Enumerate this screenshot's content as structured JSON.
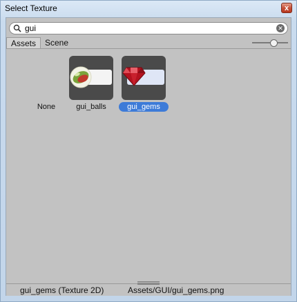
{
  "window": {
    "title": "Select Texture",
    "close_glyph": "x",
    "colors": {
      "selection": "#3d7bd8",
      "tile_bg": "#4a4a4a",
      "panel_bg": "#c2c2c2"
    }
  },
  "search": {
    "value": "gui",
    "icon": "search-icon",
    "clear_icon": "clear-icon"
  },
  "tabs": [
    {
      "label": "Assets",
      "active": true
    },
    {
      "label": "Scene",
      "active": false
    }
  ],
  "zoom_slider": {
    "value": 0.6
  },
  "items": [
    {
      "label": "None",
      "selected": false,
      "has_thumb": false
    },
    {
      "label": "gui_balls",
      "selected": false,
      "has_thumb": true,
      "icon": "balls-icon"
    },
    {
      "label": "gui_gems",
      "selected": true,
      "has_thumb": true,
      "icon": "gem-icon"
    }
  ],
  "status": {
    "selection": "gui_gems (Texture 2D)",
    "path": "Assets/GUI/gui_gems.png"
  }
}
